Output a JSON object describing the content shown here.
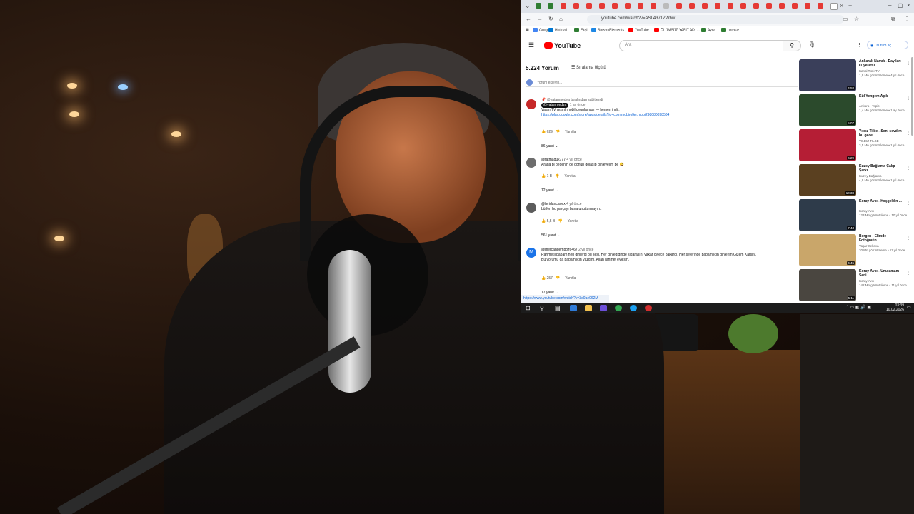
{
  "browser": {
    "url": "youtube.com/watch?v=ASL4371ZWhw",
    "bookmarks": [
      "Google",
      "Hotmail",
      "Ekşi",
      "StreamElements",
      "YouTube",
      "ÖLÜMSÜZ YAPIT ADL...",
      "Ayna",
      "parasız"
    ],
    "status_url": "https://www.youtube.com/watch?v=3e0ae062M"
  },
  "youtube": {
    "logo": "YouTube",
    "search_placeholder": "Ara",
    "signin": "Oturum aç",
    "comment_count": "5.224 Yorum",
    "sort_label": "Sıralama ölçütü",
    "add_comment": "Yorum ekleyin..."
  },
  "comments": [
    {
      "pin": "@vatanmedya tarafından sabitlendi",
      "author": "@vatanmedya",
      "time": "1 ay önce",
      "text": "Vatan TV resmî mobil uygulaması — hemen indir.",
      "link": "https://play.google.com/store/apps/details?id=com.mobiroller.mobi298080098504",
      "likes": "629",
      "reply": "Yanıtla",
      "replies": "86 yanıt"
    },
    {
      "author": "@fatmaguk777",
      "time": "4 yıl önce",
      "text": "Arada bi beğenin de dönüp dolaşıp dinleyelim be 😄",
      "likes": "1 B",
      "reply": "Yanıtla",
      "replies": "12 yanıt"
    },
    {
      "author": "@feridancanex",
      "time": "4 yıl önce",
      "text": "Lütfen bu parçayı bana unutturmayın..",
      "likes": "5,5 B",
      "reply": "Yanıtla",
      "replies": "561 yanıt"
    },
    {
      "avatar_letter": "M",
      "author": "@mercandemboz6467",
      "time": "2 yıl önce",
      "text": "Rahmetli babam hep dinlerdi bu sesi. Her dinlediğinde sigarasını yakar öylece bakardı. Her seferinde babam için dinlerim Gizem Karslıy.",
      "text2": "Bu yorumu da babam için yazdım. Allah rahmet eylesin.",
      "likes": "257",
      "reply": "Yanıtla",
      "replies": "17 yanıt"
    }
  ],
  "recommendations": [
    {
      "title": "Ankaralı Namık - Dayıları O Şerefsi...",
      "channel": "Kanal Türk TV",
      "views": "1,9 Mn görüntüleme • 4 yıl önce",
      "duration": "4:58",
      "color": "#3a3f5a"
    },
    {
      "title": "Kül Yengem Açık",
      "channel": "Ankara - Topic",
      "views": "1,4 Mn görüntüleme • 1 ay önce",
      "duration": "5:07",
      "color": "#2b4a2c"
    },
    {
      "title": "Yıldız Tilbe - Seni sevdim bu gece ...",
      "channel": "YILDIZ TILBE",
      "views": "3,5 Mn görüntüleme • 1 yıl önce",
      "duration": "6:29",
      "color": "#b51e35"
    },
    {
      "title": "Kuzey Bağlama Çalıp Şarkı ...",
      "channel": "Kuzey Bağlama",
      "views": "4,9 Mn görüntüleme • 1 yıl önce",
      "duration": "10:38",
      "color": "#5a4020"
    },
    {
      "title": "Koray Avcı - Hoşgeldin ...",
      "channel": "Koray Avcı",
      "views": "123 Mn görüntüleme • 10 yıl önce",
      "duration": "7:43",
      "color": "#2e3b4a"
    },
    {
      "title": "Bergen - Elimde Fotoğrafın",
      "channel": "Yaşar Kekeva",
      "views": "20 Mn görüntüleme • 11 yıl önce",
      "duration": "4:45",
      "color": "#c9a66a"
    },
    {
      "title": "Koray Avcı - Unutamam Seni ...",
      "channel": "Koray Avcı",
      "views": "142 Mn görüntüleme • 11 yıl önce",
      "duration": "5:11",
      "color": "#4a4640"
    }
  ],
  "taskbar": {
    "time": "03:39",
    "date": "10.02.2026"
  }
}
